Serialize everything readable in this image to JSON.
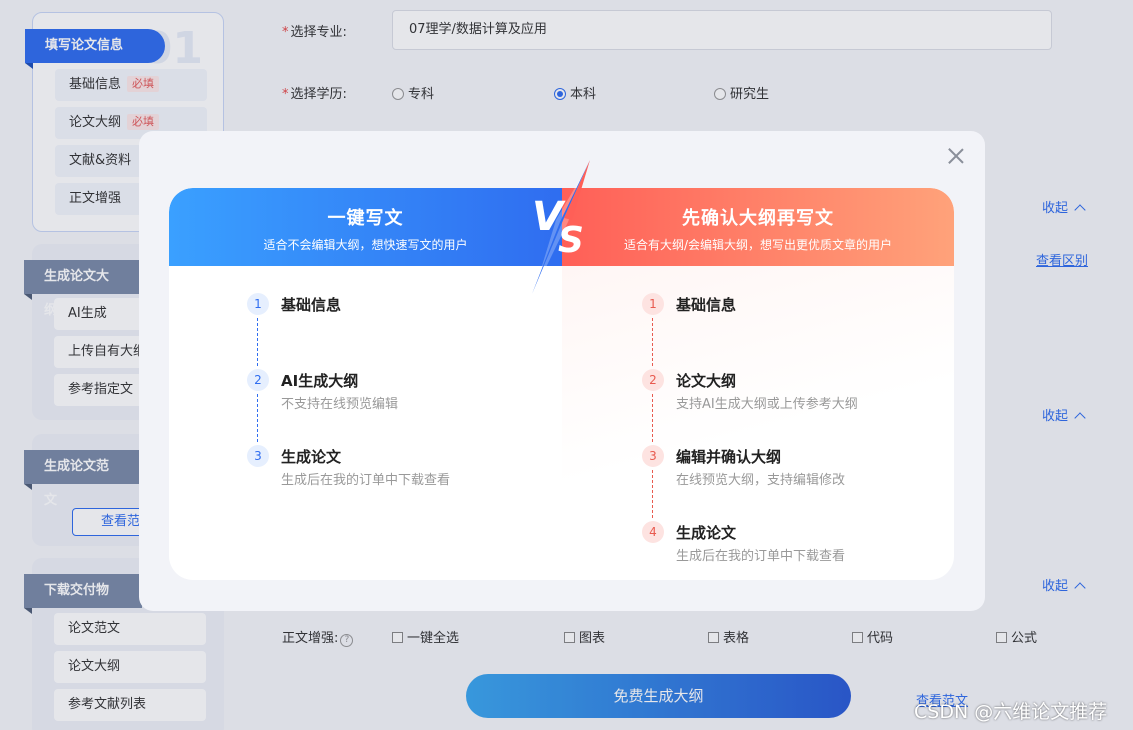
{
  "sidebar": {
    "groups": [
      {
        "title": "填写论文信息",
        "number": "01",
        "items": [
          {
            "label": "基础信息",
            "tag": "必填"
          },
          {
            "label": "论文大纲",
            "tag": "必填"
          },
          {
            "label": "文献&资料"
          },
          {
            "label": "正文增强"
          }
        ]
      },
      {
        "title": "生成论文大纲",
        "items": [
          {
            "label": "AI生成"
          },
          {
            "label": "上传自有大纲"
          },
          {
            "label": "参考指定文"
          }
        ]
      },
      {
        "title": "生成论文范文",
        "button": "查看范文"
      },
      {
        "title": "下载交付物",
        "items": [
          {
            "label": "论文范文"
          },
          {
            "label": "论文大纲"
          },
          {
            "label": "参考文献列表"
          }
        ]
      }
    ]
  },
  "form": {
    "major_label": "选择专业:",
    "major_value": "07理学/数据计算及应用",
    "degree_label": "选择学历:",
    "degree_options": [
      "专科",
      "本科",
      "研究生"
    ],
    "degree_selected": "本科",
    "collapse_label": "收起",
    "diff_link": "查看区别",
    "enhance_label": "正文增强:",
    "enhance_help": "?",
    "enhance_options": [
      "一键全选",
      "图表",
      "表格",
      "代码",
      "公式"
    ],
    "generate_button": "免费生成大纲",
    "sample_link": "查看范文"
  },
  "modal": {
    "left": {
      "title": "一键写文",
      "subtitle": "适合不会编辑大纲，想快速写文的用户",
      "steps": [
        {
          "num": "1",
          "title": "基础信息",
          "desc": ""
        },
        {
          "num": "2",
          "title": "AI生成大纲",
          "desc": "不支持在线预览编辑"
        },
        {
          "num": "3",
          "title": "生成论文",
          "desc": "生成后在我的订单中下载查看"
        }
      ]
    },
    "vs": {
      "v": "V",
      "s": "S"
    },
    "right": {
      "title": "先确认大纲再写文",
      "subtitle": "适合有大纲/会编辑大纲，想写出更优质文章的用户",
      "steps": [
        {
          "num": "1",
          "title": "基础信息",
          "desc": ""
        },
        {
          "num": "2",
          "title": "论文大纲",
          "desc": "支持AI生成大纲或上传参考大纲"
        },
        {
          "num": "3",
          "title": "编辑并确认大纲",
          "desc": "在线预览大纲，支持编辑修改"
        },
        {
          "num": "4",
          "title": "生成论文",
          "desc": "生成后在我的订单中下载查看"
        }
      ]
    },
    "colors": {
      "left_accent": "#2f6df0",
      "right_accent": "#ff5f57"
    }
  },
  "watermark": "CSDN @六维论文推荐"
}
